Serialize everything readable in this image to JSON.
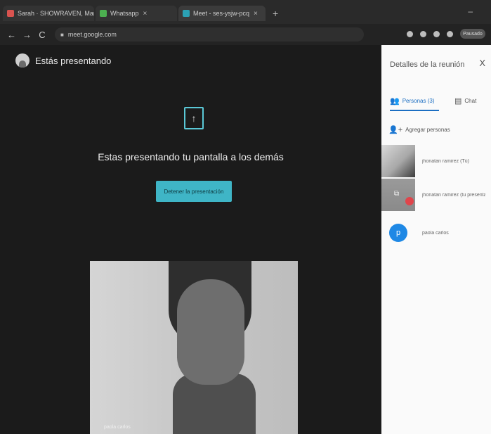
{
  "browser": {
    "tabs": [
      {
        "label": "Sarah · SHOWRAVEN, Mar Sec..."
      },
      {
        "label": "Whatsapp"
      },
      {
        "label": "Meet - ses-ysjw-pcq"
      }
    ],
    "new_tab": "+",
    "url": "meet.google.com",
    "profile": "Pausado"
  },
  "meet": {
    "presenting_label": "Estás presentando",
    "share_message": "Estas presentando tu pantalla a los demás",
    "stop_button": "Detener la presentación",
    "self_name": "paola carlos"
  },
  "panel": {
    "title": "Detalles de la reunión",
    "close": "X",
    "tabs": [
      {
        "label": "Personas (3)"
      },
      {
        "label": "Chat"
      }
    ],
    "add_people": "Agregar personas",
    "participants": [
      {
        "name": "jhonatan ramirez (Tú)"
      },
      {
        "name": "jhonatan ramirez (tu presentación)"
      },
      {
        "name": "paola carlos",
        "initial": "p"
      }
    ]
  },
  "colors": {
    "accent": "#3fb5c6",
    "people_tab": "#1b6ec2",
    "avatar_blue": "#1e88e5",
    "badge_red": "#e0454b"
  }
}
